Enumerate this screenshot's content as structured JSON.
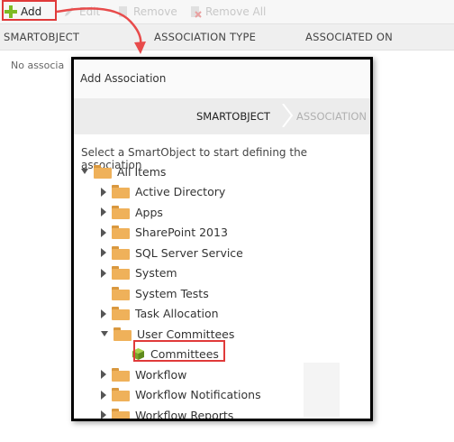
{
  "toolbar": {
    "add_label": "Add",
    "edit_label": "Edit",
    "remove_label": "Remove",
    "remove_all_label": "Remove All"
  },
  "columns": {
    "smartobject": "SMARTOBJECT",
    "association_type": "ASSOCIATION TYPE",
    "associated_on": "ASSOCIATED ON"
  },
  "empty_message": "No associa",
  "dialog": {
    "title": "Add Association",
    "wizard": {
      "step_active": "SMARTOBJECT",
      "step_next": "ASSOCIATION"
    },
    "instruction": "Select a SmartObject to start defining the association",
    "tree": [
      {
        "label": "All Items",
        "expander": "down",
        "icon": "folder-icon"
      },
      {
        "label": "Active Directory",
        "expander": "right",
        "icon": "folder-icon"
      },
      {
        "label": "Apps",
        "expander": "right",
        "icon": "folder-icon"
      },
      {
        "label": "SharePoint 2013",
        "expander": "right",
        "icon": "folder-icon"
      },
      {
        "label": "SQL Server Service",
        "expander": "right",
        "icon": "folder-icon"
      },
      {
        "label": "System",
        "expander": "right",
        "icon": "folder-icon"
      },
      {
        "label": "System Tests",
        "expander": "none",
        "icon": "folder-icon"
      },
      {
        "label": "Task Allocation",
        "expander": "right",
        "icon": "folder-icon"
      },
      {
        "label": "User Committees",
        "expander": "down",
        "icon": "folder-icon"
      },
      {
        "label": "Committees",
        "expander": "none",
        "icon": "smartobject-cube-icon"
      },
      {
        "label": "Workflow",
        "expander": "right",
        "icon": "folder-icon"
      },
      {
        "label": "Workflow Notifications",
        "expander": "right",
        "icon": "folder-icon"
      },
      {
        "label": "Workflow Reports",
        "expander": "right",
        "icon": "folder-icon"
      }
    ]
  },
  "colors": {
    "highlight": "#e03a3a",
    "add_icon": "#7dbb23",
    "folder": "#efb15a",
    "smartobject_icon": "#8bb830"
  }
}
